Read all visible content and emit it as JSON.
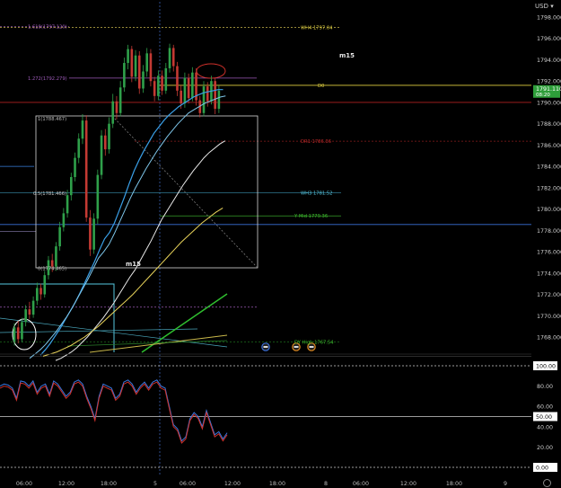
{
  "header": {
    "currency": "USD",
    "currency_dropdown_icon": "chevron-down-icon"
  },
  "colors": {
    "background": "#000000",
    "price_line": "#d8c73a",
    "current_price_bg": "#2e9e3a",
    "pivot_red": "#b11f1f",
    "fib_purple": "#9b59b6",
    "cyan": "#56c8e0",
    "green": "#3fbf2f",
    "yellow_ma": "#e8d35a",
    "white_ma": "#e9e9e9",
    "blue_ma": "#3aa0e8",
    "candle_up": "#2fa04a",
    "candle_down": "#c43a33",
    "osc_blue": "#3a78e0",
    "osc_red": "#d0302a"
  },
  "chart_data": [
    {
      "type": "line",
      "title": "",
      "timeframe_labels": [
        "m15",
        "m15"
      ],
      "ylim": [
        1766.2,
        1799.0
      ],
      "y_ticks": [
        "1798.000",
        "1796.000",
        "1794.000",
        "1792.000",
        "1790.000",
        "1788.000",
        "1786.000",
        "1784.000",
        "1782.000",
        "1780.000",
        "1778.000",
        "1776.000",
        "1774.000",
        "1772.000",
        "1770.000",
        "1768.000"
      ],
      "x_ticks": [
        "06:00",
        "12:00",
        "18:00",
        "5",
        "06:00",
        "12:00",
        "18:00",
        "8",
        "06:00",
        "12:00",
        "18:00",
        "9"
      ],
      "current_price": {
        "value": 1791.11,
        "label": "1791.110",
        "countdown": "08:20"
      },
      "levels": [
        {
          "name": "WH4",
          "label": "WH4 1797.04",
          "value": 1797.04,
          "color": "#e0d040"
        },
        {
          "name": "D0",
          "label": "D0",
          "value": 1791.6,
          "color": "#e0d040"
        },
        {
          "name": "D0 red",
          "label": "",
          "value": 1790.0,
          "color": "#b11f1f"
        },
        {
          "name": "DR1",
          "label": "DR1 1786.36",
          "value": 1786.36,
          "color": "#c02a2a"
        },
        {
          "name": "WH3",
          "label": "WH3 1781.52",
          "value": 1781.52,
          "color": "#56c8e0"
        },
        {
          "name": "Y Mid",
          "label": "Y Mid 1779.36",
          "value": 1779.36,
          "color": "#3fbf2f"
        },
        {
          "name": "blue level",
          "label": "",
          "value": 1778.55,
          "color": "#3a6fd8"
        },
        {
          "name": "DY High",
          "label": "DY High 1767.54",
          "value": 1767.54,
          "color": "#3fbf2f"
        }
      ],
      "fib_labels": [
        "1.618(1797.120)",
        "1.272(1792.279)",
        "1(1788.467)",
        "0.5(1781.466)",
        "0(1774.465)"
      ],
      "fib_values": [
        1797.12,
        1792.279,
        1788.467,
        1781.466,
        1774.465
      ],
      "oscillator": {
        "ylim": [
          0,
          100
        ],
        "levels": [
          {
            "label": "100.00",
            "value": 100
          },
          {
            "label": "50.00",
            "value": 50
          },
          {
            "label": "0.00",
            "value": 0
          }
        ],
        "ticks": [
          "80.00",
          "60.00",
          "40.00",
          "20.00"
        ],
        "series_a": [
          80,
          82,
          81,
          78,
          68,
          85,
          84,
          80,
          85,
          74,
          80,
          82,
          72,
          85,
          82,
          76,
          70,
          74,
          84,
          86,
          82,
          70,
          60,
          48,
          70,
          82,
          80,
          78,
          68,
          72,
          84,
          86,
          82,
          74,
          80,
          84,
          78,
          84,
          86,
          80,
          78,
          60,
          42,
          38,
          26,
          30,
          48,
          54,
          50,
          40,
          56,
          44,
          32,
          35,
          28,
          34
        ],
        "series_b": [
          78,
          80,
          79,
          76,
          66,
          83,
          82,
          78,
          83,
          72,
          78,
          80,
          70,
          83,
          80,
          74,
          68,
          72,
          82,
          84,
          80,
          68,
          58,
          46,
          68,
          80,
          78,
          76,
          66,
          70,
          82,
          84,
          80,
          72,
          78,
          82,
          76,
          82,
          84,
          78,
          76,
          58,
          40,
          36,
          24,
          28,
          46,
          52,
          48,
          38,
          54,
          42,
          30,
          33,
          26,
          32
        ]
      },
      "candles": [
        [
          1767.6,
          1768.9,
          1767.2,
          1769.3
        ],
        [
          1768.9,
          1767.8,
          1767.4,
          1769.5
        ],
        [
          1767.8,
          1769.4,
          1767.5,
          1769.8
        ],
        [
          1769.4,
          1770.6,
          1769.0,
          1771.0
        ],
        [
          1770.6,
          1770.1,
          1769.7,
          1771.3
        ],
        [
          1770.1,
          1771.4,
          1769.8,
          1771.8
        ],
        [
          1771.4,
          1772.6,
          1771.0,
          1773.1
        ],
        [
          1772.6,
          1772.0,
          1771.5,
          1773.0
        ],
        [
          1772.0,
          1773.8,
          1771.7,
          1774.2
        ],
        [
          1773.8,
          1775.2,
          1773.4,
          1775.6
        ],
        [
          1775.2,
          1774.6,
          1774.1,
          1775.8
        ],
        [
          1774.6,
          1776.5,
          1774.2,
          1776.9
        ],
        [
          1776.5,
          1778.3,
          1776.1,
          1778.8
        ],
        [
          1778.3,
          1779.6,
          1777.9,
          1780.1
        ],
        [
          1779.6,
          1781.3,
          1779.2,
          1781.8
        ],
        [
          1781.3,
          1783.0,
          1780.8,
          1783.4
        ],
        [
          1783.0,
          1784.8,
          1782.6,
          1785.3
        ],
        [
          1784.8,
          1786.6,
          1784.3,
          1787.1
        ],
        [
          1786.6,
          1788.3,
          1786.1,
          1788.9
        ],
        [
          1788.3,
          1779.2,
          1778.8,
          1788.8
        ],
        [
          1779.2,
          1776.2,
          1775.6,
          1779.9
        ],
        [
          1776.2,
          1779.1,
          1775.8,
          1779.6
        ],
        [
          1779.1,
          1783.2,
          1778.6,
          1783.7
        ],
        [
          1783.2,
          1786.9,
          1782.8,
          1787.4
        ],
        [
          1786.9,
          1785.6,
          1785.0,
          1787.5
        ],
        [
          1785.6,
          1788.0,
          1785.2,
          1788.6
        ],
        [
          1788.0,
          1790.1,
          1787.6,
          1790.8
        ],
        [
          1790.1,
          1789.0,
          1788.4,
          1790.6
        ],
        [
          1789.0,
          1791.4,
          1788.7,
          1792.0
        ],
        [
          1791.4,
          1793.7,
          1791.0,
          1794.2
        ],
        [
          1793.7,
          1795.0,
          1793.1,
          1795.4
        ],
        [
          1795.0,
          1792.4,
          1791.9,
          1795.3
        ],
        [
          1792.4,
          1794.4,
          1792.0,
          1794.9
        ],
        [
          1794.4,
          1791.3,
          1790.8,
          1794.8
        ],
        [
          1791.3,
          1792.9,
          1790.9,
          1793.5
        ],
        [
          1792.9,
          1794.6,
          1792.4,
          1795.1
        ],
        [
          1794.6,
          1792.0,
          1791.5,
          1795.0
        ],
        [
          1792.0,
          1790.6,
          1790.1,
          1792.4
        ],
        [
          1790.6,
          1792.5,
          1790.2,
          1793.0
        ],
        [
          1792.5,
          1791.1,
          1790.7,
          1793.0
        ],
        [
          1791.1,
          1793.2,
          1790.8,
          1793.7
        ],
        [
          1793.2,
          1795.1,
          1792.8,
          1795.5
        ],
        [
          1795.1,
          1793.4,
          1792.9,
          1795.4
        ],
        [
          1793.4,
          1791.1,
          1790.6,
          1793.8
        ],
        [
          1791.1,
          1789.9,
          1789.4,
          1791.6
        ],
        [
          1789.9,
          1792.3,
          1789.5,
          1792.8
        ],
        [
          1792.3,
          1790.4,
          1789.9,
          1792.7
        ],
        [
          1790.4,
          1792.8,
          1790.1,
          1793.3
        ],
        [
          1792.8,
          1790.2,
          1789.7,
          1793.2
        ],
        [
          1790.2,
          1789.0,
          1788.6,
          1790.6
        ],
        [
          1789.0,
          1791.5,
          1788.7,
          1792.0
        ],
        [
          1791.5,
          1790.1,
          1789.6,
          1791.9
        ],
        [
          1790.1,
          1792.0,
          1789.8,
          1792.5
        ],
        [
          1792.0,
          1789.4,
          1788.9,
          1792.3
        ],
        [
          1789.4,
          1791.1,
          1789.0,
          1791.6
        ]
      ],
      "ma_series": {
        "blue": [
          1766.3,
          1766.8,
          1767.4,
          1768.1,
          1768.8,
          1769.6,
          1770.4,
          1771.2,
          1772.1,
          1773.1,
          1774.1,
          1775.1,
          1776.2,
          1777.2,
          1777.8,
          1778.7,
          1779.9,
          1781.1,
          1782.4,
          1783.6,
          1784.6,
          1785.5,
          1786.3,
          1787.1,
          1787.7,
          1788.3,
          1788.8,
          1789.2,
          1789.6,
          1789.9,
          1790.2,
          1790.5,
          1790.7,
          1790.9,
          1791.0,
          1791.1,
          1791.2,
          1791.2
        ],
        "light_blue": [
          1766.0,
          1766.4,
          1766.8,
          1767.3,
          1767.9,
          1768.5,
          1769.2,
          1769.9,
          1770.7,
          1771.6,
          1772.5,
          1773.4,
          1774.4,
          1775.4,
          1776.0,
          1776.7,
          1777.7,
          1778.8,
          1779.9,
          1781.0,
          1782.0,
          1782.9,
          1783.8,
          1784.6,
          1785.4,
          1786.1,
          1786.8,
          1787.4,
          1788.0,
          1788.5,
          1789.0,
          1789.3,
          1789.6,
          1789.9,
          1790.1,
          1790.3,
          1790.5,
          1790.6
        ],
        "white": [
          1765.8,
          1766.0,
          1766.3,
          1766.6,
          1767.0,
          1767.5,
          1768.0,
          1768.6,
          1769.2,
          1769.8,
          1770.5,
          1771.2,
          1772.0,
          1772.8,
          1773.6,
          1774.3,
          1775.2,
          1776.1,
          1777.0,
          1778.0,
          1779.0,
          1779.8,
          1780.6,
          1781.4,
          1782.2,
          1782.9,
          1783.6,
          1784.2,
          1784.8,
          1785.3,
          1785.7,
          1786.1,
          1786.4
        ],
        "yellow": [
          1766.2,
          1766.4,
          1766.6,
          1766.9,
          1767.2,
          1767.6,
          1768.0,
          1768.5,
          1769.0,
          1769.6,
          1770.2,
          1770.8,
          1771.4,
          1772.0,
          1772.7,
          1773.4,
          1774.1,
          1774.8,
          1775.5,
          1776.2,
          1776.9,
          1777.5,
          1778.1,
          1778.7,
          1779.2,
          1779.7,
          1780.1
        ]
      }
    }
  ]
}
